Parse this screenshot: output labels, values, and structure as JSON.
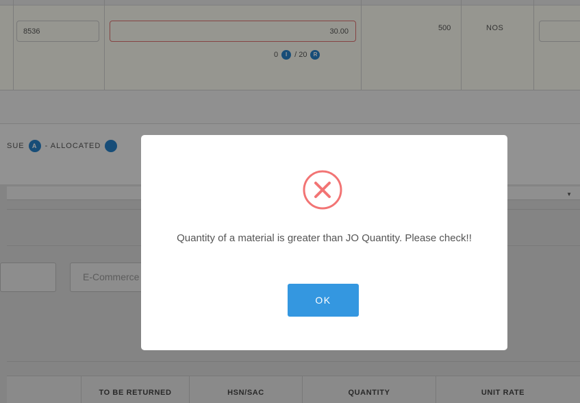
{
  "row": {
    "hsn_value": "8536",
    "quantity_value": "30.00",
    "allocation": {
      "issued": "0",
      "issued_badge": "I",
      "total": "/ 20",
      "returned_badge": "R"
    },
    "stock_value": "500",
    "unit": "NOS"
  },
  "legend": {
    "issue_suffix": "SUE",
    "allocated_badge": "A",
    "allocated_label": "- ALLOCATED"
  },
  "form": {
    "ecommerce_placeholder": "E-Commerce"
  },
  "table_header": {
    "columns": [
      "TO BE RETURNED",
      "HSN/SAC",
      "QUANTITY",
      "UNIT RATE"
    ]
  },
  "dialog": {
    "icon": "error-x-icon",
    "message": "Quantity of a material is greater than JO Quantity. Please check!!",
    "ok_label": "OK"
  },
  "colors": {
    "ok_button": "#3497e0",
    "error_icon": "#f27474",
    "badge": "#2780c8"
  }
}
